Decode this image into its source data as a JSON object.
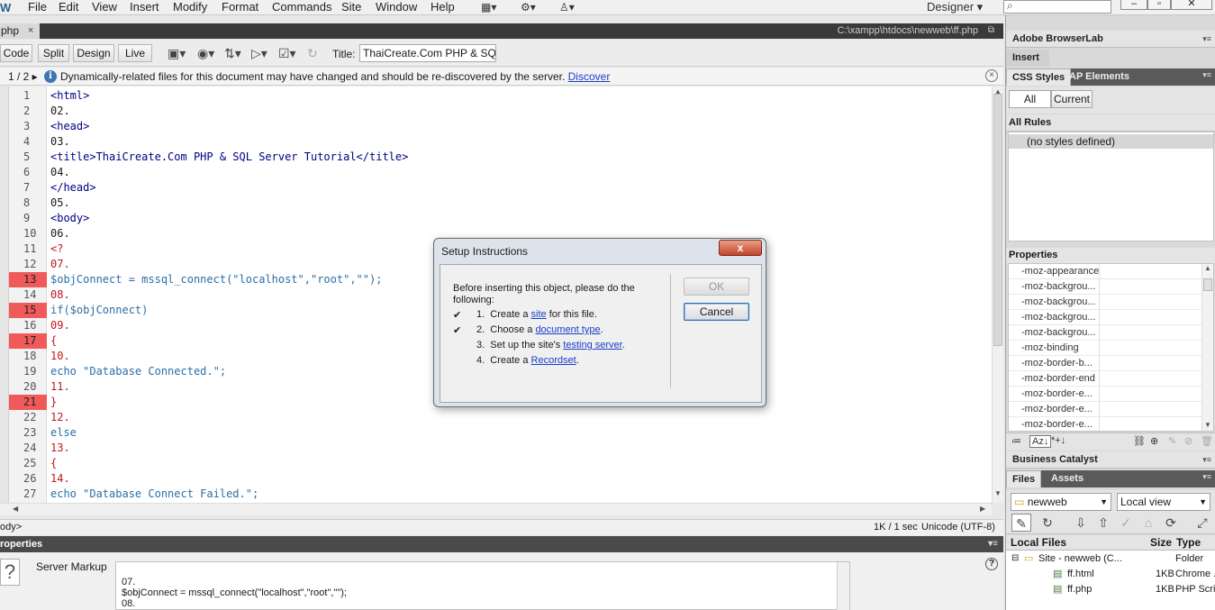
{
  "menubar": {
    "app_logo": "W",
    "items": [
      "File",
      "Edit",
      "View",
      "Insert",
      "Modify",
      "Format",
      "Commands",
      "Site",
      "Window",
      "Help"
    ],
    "workspace": "Designer",
    "workspace_arrow": "▾",
    "icons": [
      "layout-icon",
      "gear-icon",
      "extension-icon"
    ]
  },
  "doc_tab": {
    "name": "php",
    "close": "×",
    "path": "C:\\xampp\\htdocs\\newweb\\ff.php"
  },
  "doc_toolbar": {
    "views": [
      "Code",
      "Split",
      "Design",
      "Live"
    ],
    "title_label": "Title:",
    "title_value": "ThaiCreate.Com PHP & SQL Se"
  },
  "info_bar": {
    "pager": "1 / 2 ▸",
    "message": "Dynamically-related files for this document may have changed and should be re-discovered by the server.",
    "link": "Discover"
  },
  "code": {
    "lines": [
      {
        "n": "1",
        "text": "<html>",
        "cls": "tag",
        "err": false
      },
      {
        "n": "2",
        "text": "02.",
        "cls": "kw",
        "err": false
      },
      {
        "n": "3",
        "text": "<head>",
        "cls": "tag",
        "err": false
      },
      {
        "n": "4",
        "text": "03.",
        "cls": "kw",
        "err": false
      },
      {
        "n": "5",
        "text": "<title>ThaiCreate.Com PHP & SQL Server Tutorial</title>",
        "cls": "tag",
        "err": false
      },
      {
        "n": "6",
        "text": "04.",
        "cls": "kw",
        "err": false
      },
      {
        "n": "7",
        "text": "</head>",
        "cls": "tag",
        "err": false
      },
      {
        "n": "8",
        "text": "05.",
        "cls": "kw",
        "err": false
      },
      {
        "n": "9",
        "text": "<body>",
        "cls": "tag",
        "err": false
      },
      {
        "n": "10",
        "text": "06.",
        "cls": "kw",
        "err": false
      },
      {
        "n": "11",
        "text": "<?",
        "cls": "red",
        "err": false
      },
      {
        "n": "12",
        "text": "07.",
        "cls": "red",
        "err": false
      },
      {
        "n": "13",
        "text": "$objConnect = mssql_connect(\"localhost\",\"root\",\"\");",
        "cls": "php",
        "err": true
      },
      {
        "n": "14",
        "text": "08.",
        "cls": "red",
        "err": false
      },
      {
        "n": "15",
        "text": "if($objConnect)",
        "cls": "php",
        "err": true
      },
      {
        "n": "16",
        "text": "09.",
        "cls": "red",
        "err": false
      },
      {
        "n": "17",
        "text": "{",
        "cls": "red",
        "err": true
      },
      {
        "n": "18",
        "text": "10.",
        "cls": "red",
        "err": false
      },
      {
        "n": "19",
        "text": "echo \"Database Connected.\";",
        "cls": "php",
        "err": false
      },
      {
        "n": "20",
        "text": "11.",
        "cls": "red",
        "err": false
      },
      {
        "n": "21",
        "text": "}",
        "cls": "red",
        "err": true
      },
      {
        "n": "22",
        "text": "12.",
        "cls": "red",
        "err": false
      },
      {
        "n": "23",
        "text": "else",
        "cls": "php",
        "err": false
      },
      {
        "n": "24",
        "text": "13.",
        "cls": "red",
        "err": false
      },
      {
        "n": "25",
        "text": "{",
        "cls": "red",
        "err": false
      },
      {
        "n": "26",
        "text": "14.",
        "cls": "red",
        "err": false
      },
      {
        "n": "27",
        "text": "echo \"Database Connect Failed.\";",
        "cls": "php",
        "err": false
      }
    ]
  },
  "status_bar": {
    "tag_selector": "ody>",
    "size": "1K / 1 sec",
    "encoding": "Unicode (UTF-8)"
  },
  "properties_panel": {
    "title": "roperties",
    "icon": "?",
    "label": "Server Markup",
    "lines": [
      "07.",
      "$objConnect = mssql_connect(\"localhost\",\"root\",\"\");",
      "08."
    ]
  },
  "right_panels": {
    "browserlab": "Adobe BrowserLab",
    "insert": "Insert",
    "css_tabs": [
      "CSS Styles",
      "AP Elements"
    ],
    "css_modes": [
      "All",
      "Current"
    ],
    "all_rules": "All Rules",
    "no_styles": "(no styles defined)",
    "properties": "Properties",
    "property_names": [
      "-moz-appearance",
      "-moz-backgrou...",
      "-moz-backgrou...",
      "-moz-backgrou...",
      "-moz-backgrou...",
      "-moz-binding",
      "-moz-border-b...",
      "-moz-border-end",
      "-moz-border-e...",
      "-moz-border-e...",
      "-moz-border-e..."
    ],
    "property_footer": [
      "≔",
      "Az↓",
      "*+↓"
    ],
    "business_catalyst": "Business Catalyst",
    "files_tabs": [
      "Files",
      "Assets"
    ],
    "site_select": "newweb",
    "view_select": "Local view",
    "files_header": {
      "name": "Local Files",
      "size": "Size",
      "type": "Type"
    },
    "files": [
      {
        "name": "Site - newweb (C...",
        "size": "",
        "type": "Folder",
        "indent": 0
      },
      {
        "name": "ff.html",
        "size": "1KB",
        "type": "Chrome ...",
        "indent": 1
      },
      {
        "name": "ff.php",
        "size": "1KB",
        "type": "PHP Scrip",
        "indent": 1
      }
    ]
  },
  "dialog": {
    "title": "Setup Instructions",
    "close": "x",
    "intro": "Before inserting this object, please do the following:",
    "steps": [
      {
        "check": "✔",
        "prefix": "1.  Create a ",
        "link": "site",
        "suffix": " for this file."
      },
      {
        "check": "✔",
        "prefix": "2.  Choose a ",
        "link": "document type",
        "suffix": "."
      },
      {
        "check": "",
        "prefix": "3.  Set up the site's ",
        "link": "testing server",
        "suffix": "."
      },
      {
        "check": "",
        "prefix": "4.  Create a ",
        "link": "Recordset",
        "suffix": "."
      }
    ],
    "ok": "OK",
    "cancel": "Cancel"
  }
}
